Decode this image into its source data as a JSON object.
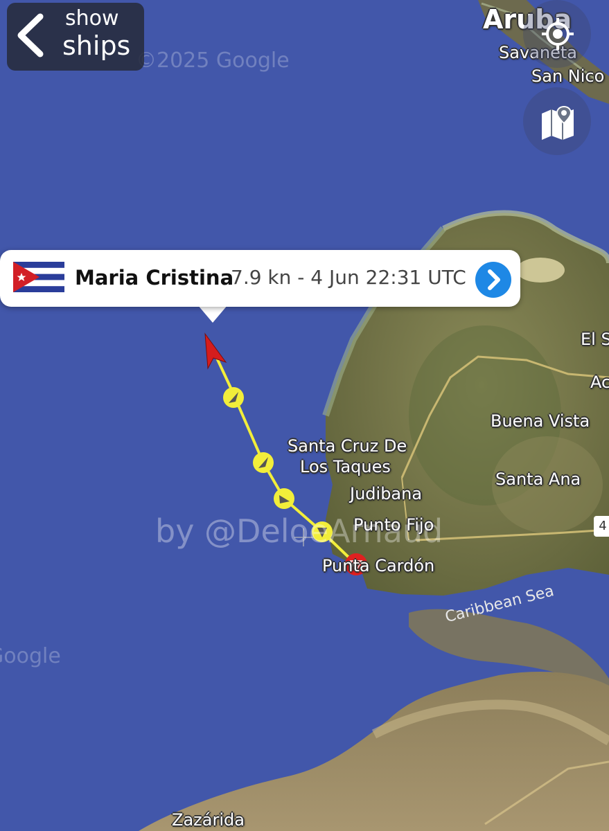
{
  "header": {
    "back_label_line1": "show",
    "back_label_line2": "ships"
  },
  "map": {
    "attribution_top": "©2025 Google",
    "attribution_left": "Google",
    "places": {
      "aruba": "Aruba",
      "savaneta": "Savaneta",
      "san_nicolas": "San Nico",
      "el_s": "El S",
      "ac": "Ac",
      "buena_vista": "Buena Vista",
      "santa_cruz_1": "Santa Cruz De",
      "santa_cruz_2": "Los Taques",
      "santa_ana": "Santa Ana",
      "judibana": "Judibana",
      "punto_fijo": "Punto Fijo",
      "punta_cardon": "Punta Cardón",
      "caribbean_sea": "Caribbean Sea",
      "zazarida": "Zazárida"
    },
    "road_badge": "4",
    "watermark": "by @DeloeArnaud"
  },
  "vessel": {
    "name": "Maria Cristina",
    "info": "7.9 kn - 4 Jun 22:31 UTC",
    "flag": "cuba-flag"
  },
  "colors": {
    "sea": "#3f55a8",
    "track": "#f2ee3a",
    "ship_arrow": "#d51d1d",
    "popup_button": "#1e88e5"
  },
  "icons": {
    "back": "chevron-left-icon",
    "locate": "locate-crosshair-icon",
    "map_layers": "map-pin-icon",
    "detail": "chevron-right-icon"
  }
}
